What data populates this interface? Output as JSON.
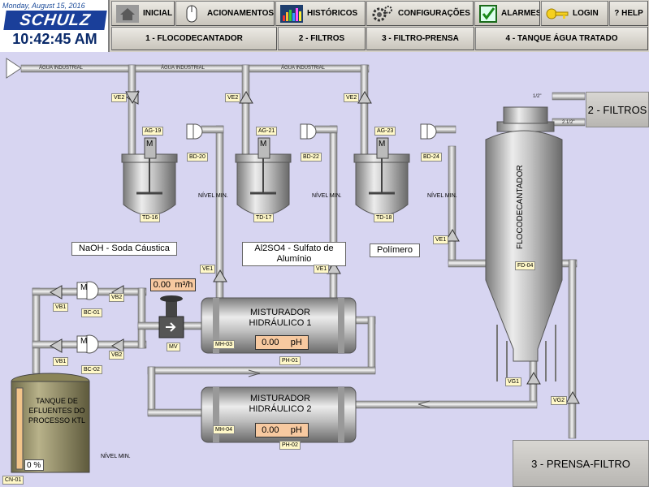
{
  "header": {
    "date": "Monday, August 15, 2016",
    "brand": "SCHULZ",
    "time": "10:42:45 AM"
  },
  "nav": {
    "inicial": "INICIAL",
    "acionamentos": "ACIONAMENTOS",
    "historicos": "HISTÓRICOS",
    "configuracoes": "CONFIGURAÇÕES",
    "alarmes": "ALARMES",
    "login": "LOGIN",
    "help": "? HELP"
  },
  "tabs": {
    "t1": "1 - FLOCODECANTADOR",
    "t2": "2 - FILTROS",
    "t3": "3 - FILTRO-PRENSA",
    "t4": "4 - TANQUE ÁGUA TRATADO"
  },
  "pipes": {
    "agua1": "ÁGUA INDUSTRIAL",
    "agua2": "ÁGUA INDUSTRIAL",
    "agua3": "ÁGUA INDUSTRIAL",
    "half": "1/2\"",
    "twohalf": "2.1/2\""
  },
  "tags": {
    "ve2a": "VE2",
    "ve2b": "VE2",
    "ve2c": "VE2",
    "ag19": "AG-19",
    "ag21": "AG-21",
    "ag23": "AG-23",
    "bd20": "BD-20",
    "bd22": "BD-22",
    "bd24": "BD-24",
    "td16": "TD-16",
    "td17": "TD-17",
    "td18": "TD-18",
    "ve1a": "VE1",
    "ve1b": "VE1",
    "ve1c": "VE1",
    "fd04": "FD-04",
    "vb1a": "VB1",
    "vb1b": "VB1",
    "bc01": "BC-01",
    "bc02": "BC-02",
    "vb2a": "VB2",
    "vb2b": "VB2",
    "mv": "MV",
    "mh03": "MH-03",
    "mh04": "MH-04",
    "ph01": "PH-01",
    "ph02": "PH-02",
    "vg1": "VG1",
    "vg2": "VG2",
    "cn01": "CN-01"
  },
  "tanks": {
    "naoh": "NaOH - Soda Cáustica",
    "al": "Al2SO4 - Sulfato de Alumínio",
    "poli": "Polímero",
    "floc": "FLOCODECANTADOR",
    "efluentes": "TANQUE DE EFLUENTES DO PROCESSO KTL",
    "level_pct": "0 %",
    "level_fraction": 0.0
  },
  "nivel": {
    "n1": "NÍVEL MIN.",
    "n2": "NÍVEL MIN.",
    "n3": "NÍVEL MIN.",
    "n4": "NÍVEL MIN."
  },
  "motor": "M",
  "mixers": {
    "m1": "MISTURADOR HIDRÁULICO 1",
    "m2": "MISTURADOR HIDRÁULICO 2"
  },
  "readouts": {
    "flow_value": "0.00",
    "flow_unit": "m³/h",
    "ph1_value": "0.00",
    "ph1_unit": "pH",
    "ph2_value": "0.00",
    "ph2_unit": "pH"
  },
  "dest": {
    "filtros": "2 - FILTROS",
    "prensa": "3 - PRENSA-FILTRO"
  },
  "colors": {
    "background": "#d7d5f1",
    "pipe": "#c8c8c8",
    "readout": "#f7c9a0",
    "tag": "#fff8c8",
    "tank_effluent": "#9a9468",
    "tank_level": "#f2c48a"
  }
}
